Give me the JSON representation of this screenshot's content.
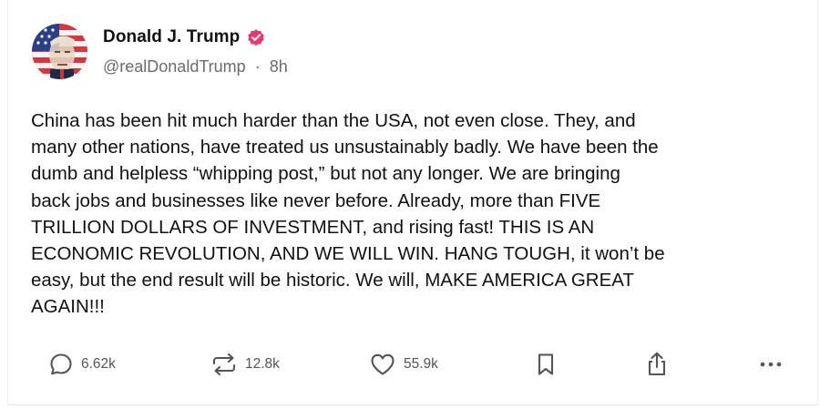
{
  "author": {
    "display_name": "Donald J. Trump",
    "handle": "@realDonaldTrump",
    "separator": "·",
    "time_ago": "8h",
    "verified": true,
    "verified_color": "#e8386e"
  },
  "post": {
    "lines": [
      "China has been hit much harder than the USA, not even close. They, and",
      "many other nations, have treated us unsustainably badly. We have been the",
      "dumb and helpless “whipping post,” but not any longer. We are bringing",
      "back jobs and businesses like never before. Already, more than FIVE",
      "TRILLION DOLLARS OF INVESTMENT, and rising fast! THIS IS AN",
      "ECONOMIC REVOLUTION, AND WE WILL WIN. HANG TOUGH, it won’t be",
      "easy, but the end result will be historic. We will, MAKE AMERICA GREAT",
      "AGAIN!!!"
    ]
  },
  "actions": {
    "replies": "6.62k",
    "reposts": "12.8k",
    "likes": "55.9k"
  },
  "icons": {
    "reply": "reply-bubble-icon",
    "repost": "repost-arrows-icon",
    "like": "heart-icon",
    "bookmark": "bookmark-icon",
    "share": "share-upload-icon",
    "more": "more-dots-icon"
  }
}
